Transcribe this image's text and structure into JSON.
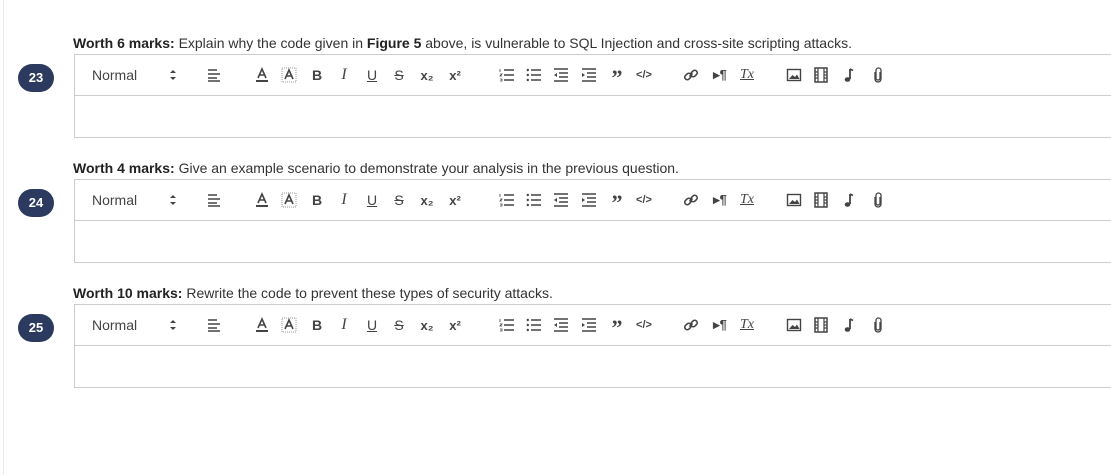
{
  "questions": [
    {
      "number": "23",
      "marks_label": "Worth 6 marks:",
      "text_before": "Explain why the code given in ",
      "bold_ref": "Figure 5",
      "text_after": " above, is vulnerable to SQL Injection and cross-site scripting attacks."
    },
    {
      "number": "24",
      "marks_label": "Worth 4 marks:",
      "text_before": "Give an example scenario to demonstrate your analysis in the previous question.",
      "bold_ref": "",
      "text_after": ""
    },
    {
      "number": "25",
      "marks_label": "Worth 10 marks:",
      "text_before": "Rewrite the code to prevent these types of security attacks.",
      "bold_ref": "",
      "text_after": ""
    }
  ],
  "toolbar": {
    "format_value": "Normal",
    "arrows_glyph": "⬍",
    "bold_glyph": "B",
    "italic_glyph": "I",
    "underline_glyph": "U",
    "strike_glyph": "S",
    "subscript_glyph": "x₂",
    "superscript_glyph": "x²",
    "blockquote_glyph": "”",
    "code_glyph": "</>",
    "direction_glyph": "▸¶",
    "clean_glyph": "Tx",
    "icons": [
      "align-icon",
      "font-color-icon",
      "background-color-icon",
      "bold-icon",
      "italic-icon",
      "underline-icon",
      "strikethrough-icon",
      "subscript-icon",
      "superscript-icon",
      "ordered-list-icon",
      "bullet-list-icon",
      "outdent-icon",
      "indent-icon",
      "blockquote-icon",
      "code-block-icon",
      "link-icon",
      "text-direction-icon",
      "clear-formatting-icon",
      "image-icon",
      "video-icon",
      "audio-icon",
      "attachment-icon"
    ]
  },
  "colors": {
    "badge": "#2b3a5e",
    "border": "#cccccc",
    "text": "#333333"
  }
}
